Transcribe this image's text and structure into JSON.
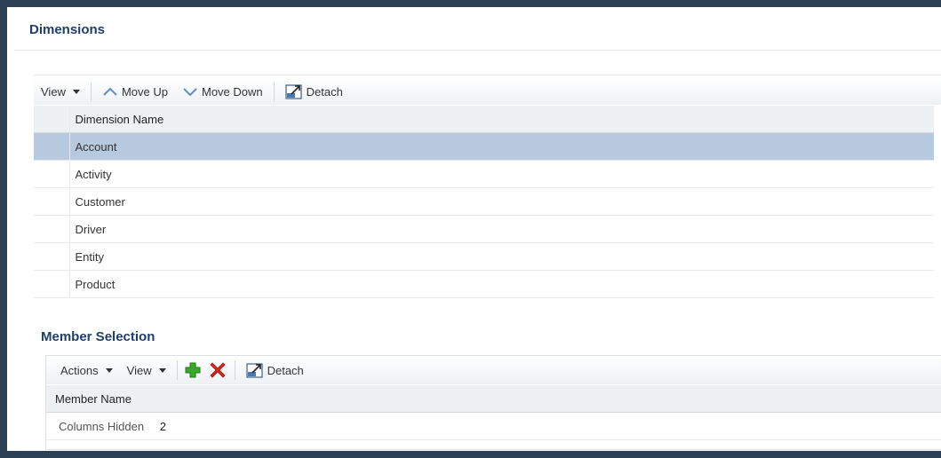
{
  "dimensions": {
    "title": "Dimensions",
    "toolbar": {
      "view_label": "View",
      "move_up_label": "Move Up",
      "move_down_label": "Move Down",
      "detach_label": "Detach"
    },
    "column_header": "Dimension Name",
    "rows": [
      "Account",
      "Activity",
      "Customer",
      "Driver",
      "Entity",
      "Product"
    ],
    "selected_row": "Account"
  },
  "member_selection": {
    "title": "Member Selection",
    "toolbar": {
      "actions_label": "Actions",
      "view_label": "View",
      "add_icon": "add-icon",
      "delete_icon": "delete-icon",
      "detach_label": "Detach"
    },
    "column_header": "Member Name",
    "columns_hidden_label": "Columns Hidden",
    "columns_hidden_count": "2"
  },
  "colors": {
    "title": "#1f3f6b",
    "selected_row": "#b6c9de",
    "frame_border": "#2b3f55",
    "add": "#3aa829",
    "delete": "#d8261b"
  }
}
